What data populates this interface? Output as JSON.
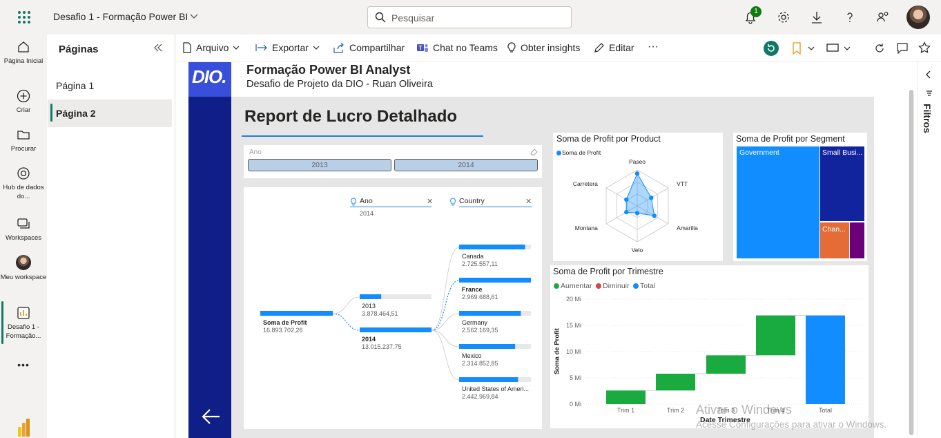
{
  "topbar": {
    "title": "Desafio 1 - Formação Power BI",
    "search_placeholder": "Pesquisar",
    "notification_count": "1",
    "icons": [
      "waffle-icon",
      "bell-icon",
      "gear-icon",
      "download-icon",
      "help-icon",
      "share-people-icon",
      "avatar"
    ]
  },
  "rail": {
    "items": [
      {
        "label": "Página Inicial",
        "icon": "home-icon"
      },
      {
        "label": "Criar",
        "icon": "plus-circle-icon"
      },
      {
        "label": "Procurar",
        "icon": "folder-icon"
      },
      {
        "label": "Hub de dados do...",
        "icon": "data-hub-icon"
      },
      {
        "label": "Workspaces",
        "icon": "workspaces-icon"
      },
      {
        "label": "Meu workspace",
        "icon": "avatar"
      },
      {
        "label": "Desafio 1 - Formação...",
        "icon": "report-icon"
      }
    ],
    "more": "•••"
  },
  "pages_pane": {
    "title": "Páginas",
    "pages": [
      "Página 1",
      "Página 2"
    ],
    "selected": "Página 2"
  },
  "toolbar": {
    "arquivo": "Arquivo",
    "exportar": "Exportar",
    "compartilhar": "Compartilhar",
    "chat_teams": "Chat no Teams",
    "insights": "Obter insights",
    "editar": "Editar",
    "more": "···"
  },
  "filters": {
    "label": "Filtros"
  },
  "report": {
    "logo": "DIO.",
    "title": "Formação Power BI Analyst",
    "subtitle": "Desafio de Projeto da DIO - Ruan Oliveira",
    "heading": "Report de Lucro Detalhado",
    "slicer": {
      "label": "Ano",
      "options": [
        "2013",
        "2014"
      ]
    },
    "decomposition": {
      "levels": [
        {
          "name": "Ano",
          "value": "2014"
        },
        {
          "name": "Country",
          "value": ""
        }
      ],
      "root": {
        "label": "Soma de Profit",
        "value": "16.893.702,26"
      },
      "years": [
        {
          "label": "2013",
          "value": "3.878.464,51",
          "fraction": 0.3
        },
        {
          "label": "2014",
          "value": "13.015.237,75",
          "fraction": 1.0
        }
      ],
      "countries": [
        {
          "label": "Canada",
          "value": "2.725.557,11",
          "fraction": 0.92
        },
        {
          "label": "France",
          "value": "2.969.688,61",
          "fraction": 1.0
        },
        {
          "label": "Germany",
          "value": "2.562.169,35",
          "fraction": 0.86
        },
        {
          "label": "Mexico",
          "value": "2.314.852,85",
          "fraction": 0.78
        },
        {
          "label": "United States of Ameri...",
          "value": "2.442.969,84",
          "fraction": 0.82
        }
      ]
    },
    "radar": {
      "title": "Soma de Profit por Product",
      "legend": "Soma de Profit",
      "axes": [
        "Paseo",
        "VTT",
        "Amarilla",
        "Velo",
        "Montana",
        "Carretera"
      ]
    },
    "treemap": {
      "title": "Soma de Profit por Segment",
      "segments": [
        "Government",
        "Small Busi...",
        "Chan..."
      ]
    },
    "waterfall": {
      "title": "Soma de Profit por Trimestre",
      "legend": [
        "Aumentar",
        "Diminuir",
        "Total"
      ],
      "ylabel": "Soma de Profit",
      "xlabel": "Date Trimestre",
      "yticks": [
        "20 Mi",
        "15 Mi",
        "10 Mi",
        "5 Mi",
        "0 Mi"
      ]
    },
    "watermark": {
      "line1": "Ativar o Windows",
      "line2": "Acesse Configurações para ativar o Windows."
    }
  },
  "colors": {
    "navy": "#0f1f87",
    "blue": "#118dff",
    "green": "#1aab40",
    "red": "#d64550",
    "accent": "#117865"
  },
  "chart_data": [
    {
      "type": "radar",
      "title": "Soma de Profit por Product",
      "categories": [
        "Paseo",
        "VTT",
        "Amarilla",
        "Velo",
        "Montana",
        "Carretera"
      ],
      "series": [
        {
          "name": "Soma de Profit",
          "values": [
            0.9,
            0.45,
            0.55,
            0.2,
            0.35,
            0.35
          ]
        }
      ]
    },
    {
      "type": "treemap",
      "title": "Soma de Profit por Segment",
      "categories": [
        "Government",
        "Small Busi...",
        "Chan...",
        ""
      ],
      "values": [
        11.4,
        3.1,
        1.6,
        0.8
      ],
      "colors": [
        "#118dff",
        "#12239e",
        "#e66c37",
        "#6b007b"
      ]
    },
    {
      "type": "bar",
      "subtype": "waterfall",
      "title": "Soma de Profit por Trimestre",
      "xlabel": "Date Trimestre",
      "ylabel": "Soma de Profit",
      "ylim": [
        0,
        20
      ],
      "categories": [
        "Trim 1",
        "Trim 2",
        "Trim 3",
        "Trim 4",
        "Total"
      ],
      "values": [
        2.6,
        3.2,
        3.5,
        7.6,
        16.9
      ],
      "kinds": [
        "Aumentar",
        "Aumentar",
        "Aumentar",
        "Aumentar",
        "Total"
      ]
    }
  ]
}
